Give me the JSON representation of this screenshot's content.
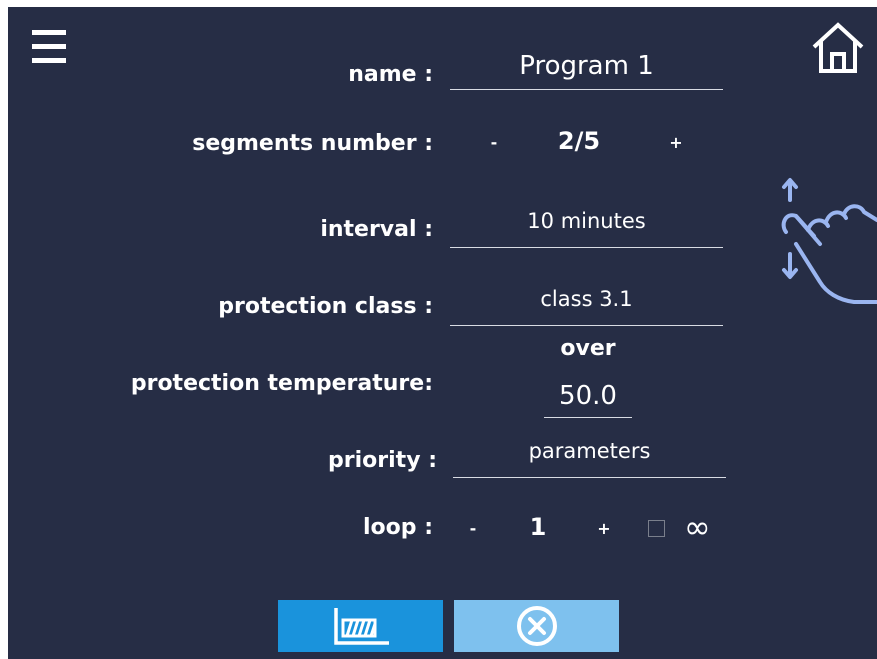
{
  "form": {
    "name_label": "name :",
    "name_value": "Program 1",
    "segments_label": "segments number :",
    "segments_minus": "-",
    "segments_value": "2/5",
    "segments_plus": "+",
    "interval_label": "interval :",
    "interval_value": "10 minutes",
    "protection_class_label": "protection class :",
    "protection_class_value": "class 3.1",
    "protection_temp_label": "protection temperature:",
    "protection_temp_mode": "over",
    "protection_temp_value": "50.0",
    "priority_label": "priority :",
    "priority_value": "parameters",
    "loop_label": "loop :",
    "loop_minus": "-",
    "loop_value": "1",
    "loop_plus": "+",
    "loop_infinite_symbol": "∞",
    "loop_infinite_checked": false
  },
  "icons": {
    "menu": "hamburger-menu-icon",
    "home": "home-icon",
    "scroll_hint": "swipe-hand-icon",
    "chart": "bar-chart-icon",
    "cancel": "close-circle-icon"
  },
  "colors": {
    "background": "#262d45",
    "chart_button": "#1a93dc",
    "cancel_button": "#7ec1ee",
    "scroll_hand": "#9ab5f0"
  }
}
